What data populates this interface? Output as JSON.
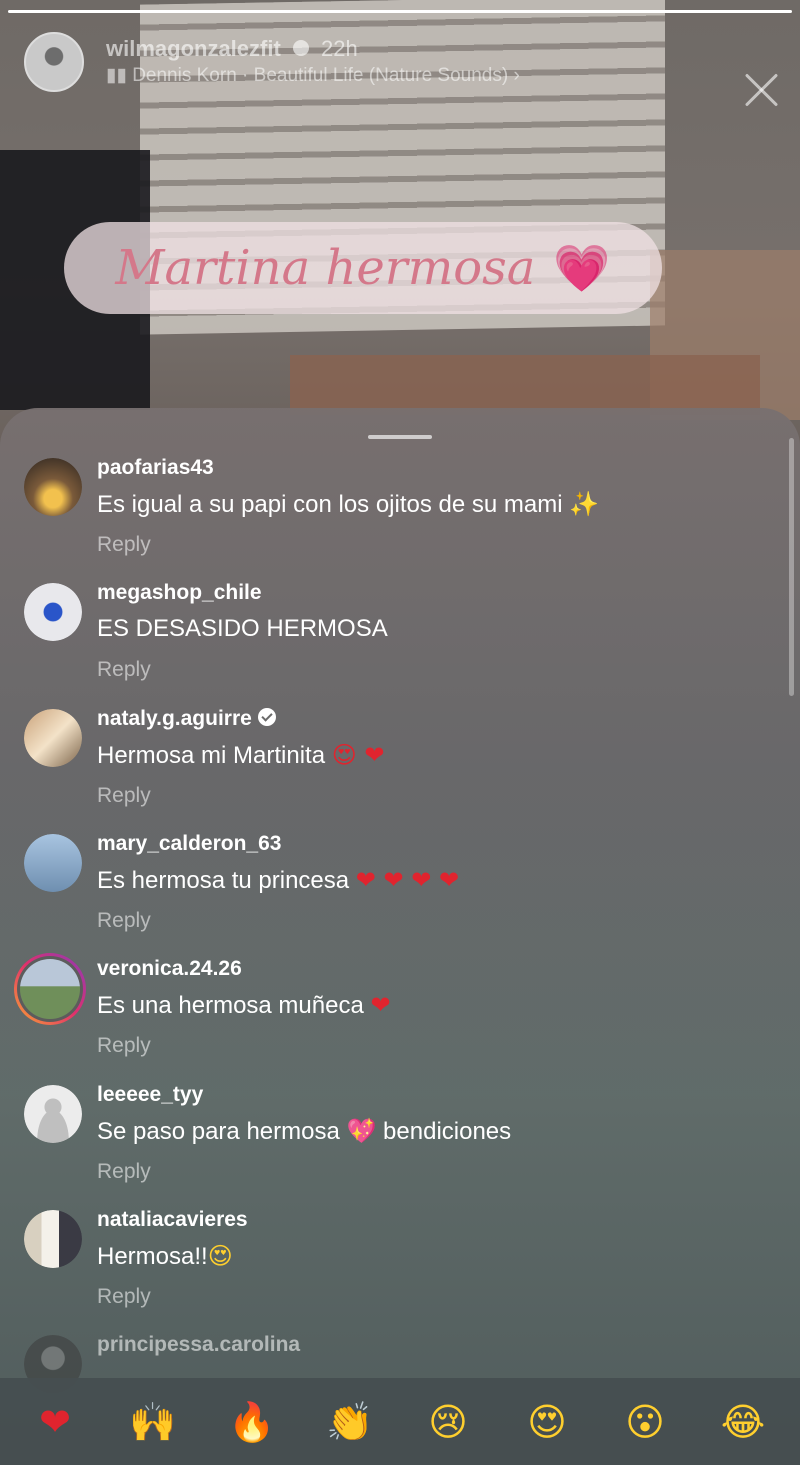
{
  "story": {
    "author": "wilmagonzalezfit",
    "time": "22h",
    "music": "Dennis Korn · Beautiful Life (Nature Sounds)",
    "music_icon": "▮▮",
    "music_chevron": "›",
    "sticker_text": "Martina hermosa",
    "sticker_emoji": "💗",
    "progress": 1.0
  },
  "comments": [
    {
      "user": "paofarias43",
      "text": "Es igual a su papi con los ojitos de su mami",
      "emoji": "✨",
      "reply": "Reply",
      "verified": false
    },
    {
      "user": "megashop_chile",
      "text": "ES DESASIDO HERMOSA",
      "emoji": "",
      "reply": "Reply",
      "verified": false
    },
    {
      "user": "nataly.g.aguirre",
      "text": "Hermosa mi Martinita",
      "emoji": "😍 ❤",
      "reply": "Reply",
      "verified": true
    },
    {
      "user": "mary_calderon_63",
      "text": "Es hermosa tu princesa",
      "emoji": "❤ ❤ ❤ ❤",
      "reply": "Reply",
      "verified": false
    },
    {
      "user": "veronica.24.26",
      "text": "Es una hermosa muñeca",
      "emoji": "❤",
      "reply": "Reply",
      "verified": false
    },
    {
      "user": "leeeee_tyy",
      "text": "Se paso para hermosa",
      "emoji": "💖",
      "text_after": "bendiciones",
      "reply": "Reply",
      "verified": false
    },
    {
      "user": "nataliacavieres",
      "text": "Hermosa!!",
      "emoji": "😍",
      "reply": "Reply",
      "verified": false
    },
    {
      "user": "principessa.carolina",
      "text": "",
      "emoji": "",
      "reply": "",
      "verified": false
    }
  ],
  "avatar_colors": [
    "#7a5a3a",
    "#e8e8ec",
    "#c9a27a",
    "#8fa8c0",
    "#6f8f5a",
    "#d8d8d8",
    "#a8a08c",
    "#3c3c3c"
  ],
  "reactions": [
    {
      "name": "heart",
      "glyph": "❤"
    },
    {
      "name": "raised-hands",
      "glyph": "🙌"
    },
    {
      "name": "fire",
      "glyph": "🔥"
    },
    {
      "name": "clapping",
      "glyph": "👏"
    },
    {
      "name": "crying",
      "glyph": "😢"
    },
    {
      "name": "heart-eyes",
      "glyph": "😍"
    },
    {
      "name": "surprised",
      "glyph": "😮"
    },
    {
      "name": "laughing",
      "glyph": "😂"
    }
  ]
}
